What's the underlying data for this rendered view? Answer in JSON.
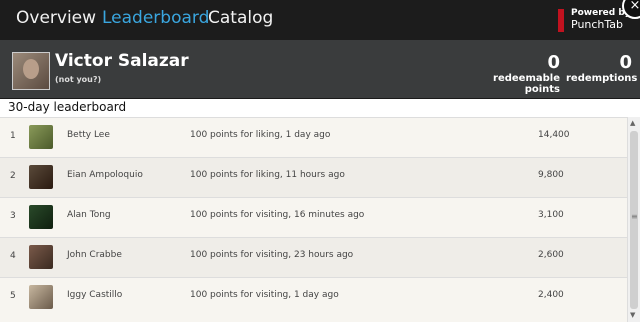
{
  "nav": {
    "tabs": [
      {
        "label": "Overview",
        "active": false
      },
      {
        "label": "Leaderboard",
        "active": true
      },
      {
        "label": "Catalog",
        "active": false
      }
    ],
    "powered_by": "Powered by",
    "brand": "PunchTab",
    "close_glyph": "×"
  },
  "user": {
    "name": "Victor Salazar",
    "not_you": "(not you?)",
    "redeemable_points": "0",
    "redeemable_label": "redeemable points",
    "redemptions": "0",
    "redemptions_label": "redemptions"
  },
  "leaderboard": {
    "title": "30-day leaderboard",
    "rows": [
      {
        "rank": "1",
        "name": "Betty Lee",
        "activity": "100 points for liking, 1 day ago",
        "points": "14,400"
      },
      {
        "rank": "2",
        "name": "Eian Ampoloquio",
        "activity": "100 points for liking, 11 hours ago",
        "points": "9,800"
      },
      {
        "rank": "3",
        "name": "Alan Tong",
        "activity": "100 points for visiting, 16 minutes ago",
        "points": "3,100"
      },
      {
        "rank": "4",
        "name": "John Crabbe",
        "activity": "100 points for visiting, 23 hours ago",
        "points": "2,600"
      },
      {
        "rank": "5",
        "name": "Iggy Castillo",
        "activity": "100 points for visiting, 1 day ago",
        "points": "2,400"
      }
    ]
  },
  "colors": {
    "nav_bg": "#1c1c1c",
    "active_tab": "#3aa6df",
    "user_bar_bg": "#3a3c3d",
    "brand_red": "#c1121f",
    "row_bg_odd": "#f7f5f0",
    "row_bg_even": "#efede8"
  },
  "icons": {
    "close": "close-icon",
    "punchtab_logo": "punchtab-logo-icon",
    "scroll_up": "scroll-up-arrow-icon",
    "scroll_down": "scroll-down-arrow-icon"
  }
}
